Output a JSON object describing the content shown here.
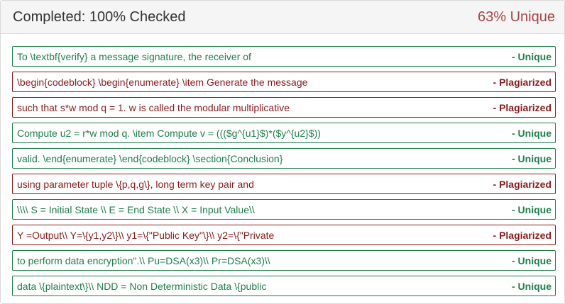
{
  "header": {
    "title": "Completed: 100% Checked",
    "unique_percent": "63% Unique"
  },
  "colors": {
    "unique": "#1e7e4a",
    "plagiarized": "#8b1a1a",
    "unique_percent": "#a94442"
  },
  "results": [
    {
      "text": "To \\textbf{verify} a message signature, the receiver of",
      "status": "- Unique",
      "kind": "unique"
    },
    {
      "text": "\\begin{codeblock} \\begin{enumerate} \\item Generate the message",
      "status": "- Plagiarized",
      "kind": "plag"
    },
    {
      "text": "such that s*w mod q = 1. w is called the modular multiplicative",
      "status": "- Plagiarized",
      "kind": "plag"
    },
    {
      "text": "Compute u2 = r*w mod q. \\item Compute v = ((($g^{u1}$)*($y^{u2}$))",
      "status": "- Unique",
      "kind": "unique"
    },
    {
      "text": "valid. \\end{enumerate} \\end{codeblock} \\section{Conclusion}",
      "status": "- Unique",
      "kind": "unique"
    },
    {
      "text": "using parameter tuple \\{p,q,g\\}, long term key pair and",
      "status": "- Plagiarized",
      "kind": "plag"
    },
    {
      "text": "\\\\\\\\ S = Initial State \\\\ E = End State \\\\ X = Input Value\\\\",
      "status": "- Unique",
      "kind": "unique"
    },
    {
      "text": "Y =Output\\\\ Y=\\{y1,y2\\}\\\\ y1=\\{\"Public Key\"\\}\\\\ y2=\\{\"Private",
      "status": "- Plagiarized",
      "kind": "plag"
    },
    {
      "text": "to perform data encryption\".\\\\ Pu=DSA(x3)\\\\ Pr=DSA(x3)\\\\",
      "status": "- Unique",
      "kind": "unique"
    },
    {
      "text": "data \\{plaintext\\}\\\\ NDD = Non Deterministic Data \\{public",
      "status": "- Unique",
      "kind": "unique"
    }
  ]
}
